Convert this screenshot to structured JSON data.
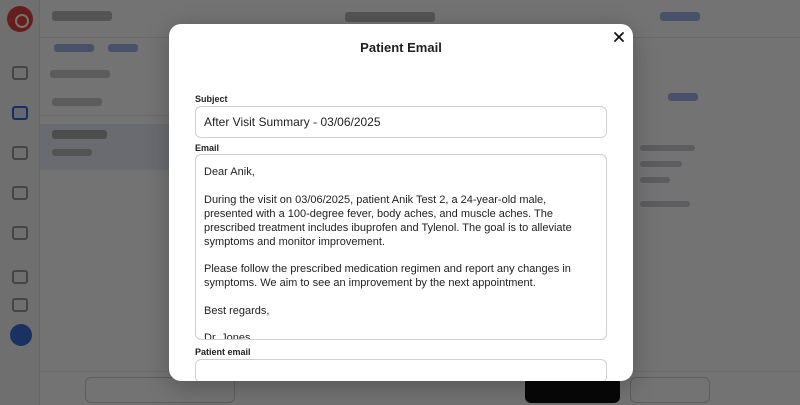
{
  "modal": {
    "title": "Patient Email",
    "subject_label": "Subject",
    "subject_value": "After Visit Summary - 03/06/2025",
    "email_label": "Email",
    "email_greeting": "Dear Anik,",
    "email_paragraph_1": "During the visit on 03/06/2025, patient Anik Test 2, a 24-year-old male, presented with a 100-degree fever, body aches, and muscle aches. The prescribed treatment includes ibuprofen and Tylenol. The goal is to alleviate symptoms and monitor improvement.",
    "email_paragraph_2": "Please follow the prescribed medication regimen and report any changes in symptoms. We aim to see an improvement by the next appointment.",
    "email_closing": "Best regards,",
    "email_signature": "Dr. Jones",
    "patient_email_label": "Patient email",
    "patient_email_value": ""
  },
  "colors": {
    "overlay": "#000000",
    "accent": "#3867d6",
    "brand": "#e0443c"
  },
  "icons": {
    "close": "close-icon",
    "logo": "logo-icon"
  }
}
